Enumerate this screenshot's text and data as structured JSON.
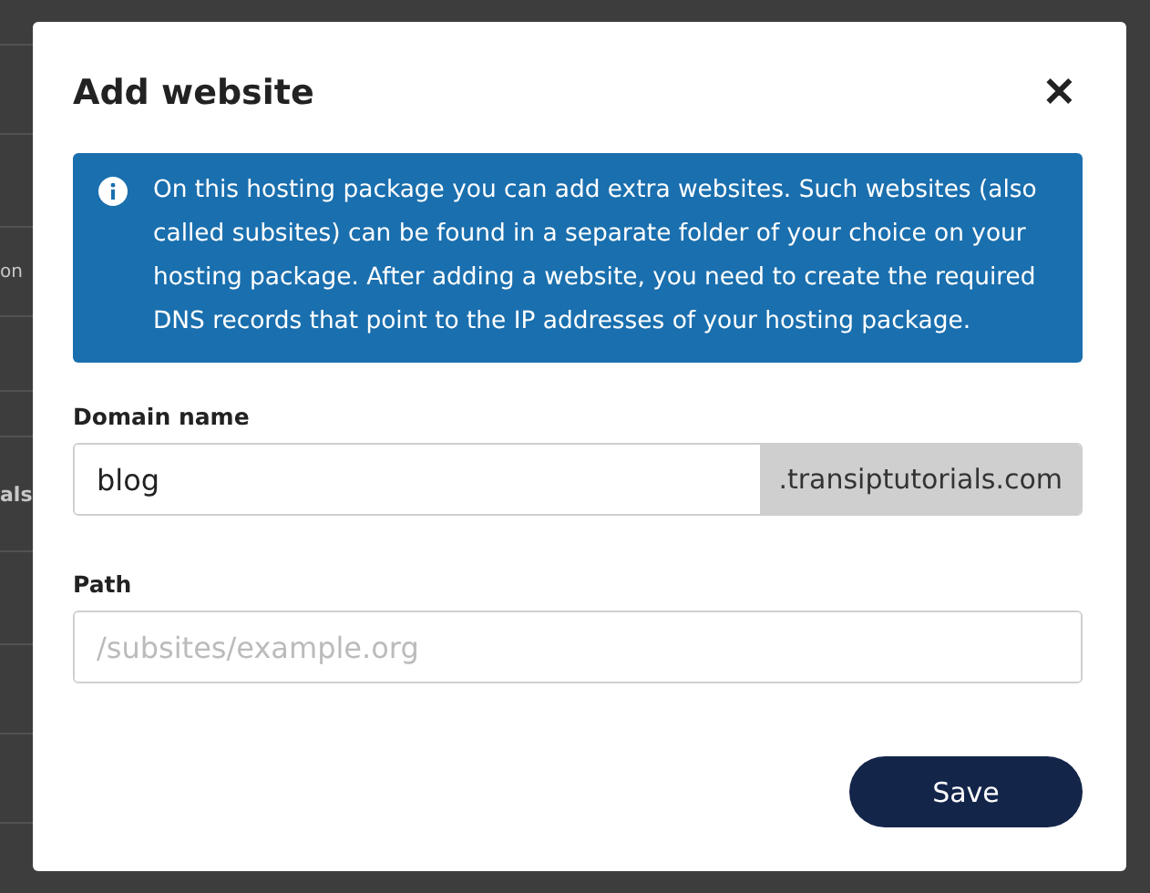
{
  "background": {
    "texts": [
      "on",
      "als"
    ]
  },
  "dialog": {
    "title": "Add website",
    "close_label": "✕",
    "info": "On this hosting package you can add extra websites. Such websites (also called subsites) can be found in a separate folder of your choice on your hosting package. After adding a website, you need to create the required DNS records that point to the IP addresses of your hosting package.",
    "fields": [
      {
        "label": "Domain name",
        "value": "blog",
        "suffix": ".transiptutorials.com"
      },
      {
        "label": "Path",
        "placeholder": "/subsites/example.org"
      }
    ],
    "buttons": [
      "Save"
    ]
  }
}
